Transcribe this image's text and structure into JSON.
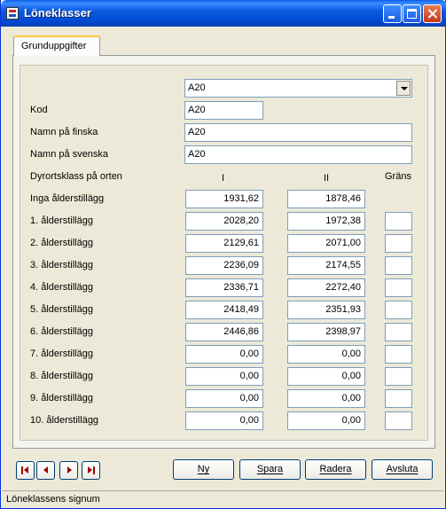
{
  "window": {
    "title": "Löneklasser"
  },
  "tab": {
    "label": "Grunduppgifter"
  },
  "selector": {
    "value": "A20"
  },
  "fields": {
    "kod_label": "Kod",
    "kod": "A20",
    "fi_label": "Namn på finska",
    "fi": "A20",
    "sv_label": "Namn på svenska",
    "sv": "A20"
  },
  "grid": {
    "header_label": "Dyrortsklass på orten",
    "col1": "I",
    "col2": "II",
    "col3": "Gräns",
    "rows": [
      {
        "label": "Inga ålderstillägg",
        "v1": "1931,62",
        "v2": "1878,46"
      },
      {
        "label": "1. ålderstillägg",
        "v1": "2028,20",
        "v2": "1972,38"
      },
      {
        "label": "2. ålderstillägg",
        "v1": "2129,61",
        "v2": "2071,00"
      },
      {
        "label": "3. ålderstillägg",
        "v1": "2236,09",
        "v2": "2174,55"
      },
      {
        "label": "4. ålderstillägg",
        "v1": "2336,71",
        "v2": "2272,40"
      },
      {
        "label": "5. ålderstillägg",
        "v1": "2418,49",
        "v2": "2351,93"
      },
      {
        "label": "6. ålderstillägg",
        "v1": "2446,86",
        "v2": "2398,97"
      },
      {
        "label": "7. ålderstillägg",
        "v1": "0,00",
        "v2": "0,00"
      },
      {
        "label": "8. ålderstillägg",
        "v1": "0,00",
        "v2": "0,00"
      },
      {
        "label": "9. ålderstillägg",
        "v1": "0,00",
        "v2": "0,00"
      },
      {
        "label": "10. ålderstillägg",
        "v1": "0,00",
        "v2": "0,00"
      }
    ]
  },
  "buttons": {
    "ny": "Ny",
    "spara": "Spara",
    "radera": "Radera",
    "avsluta": "Avsluta"
  },
  "status": {
    "text": "Löneklassens signum"
  }
}
